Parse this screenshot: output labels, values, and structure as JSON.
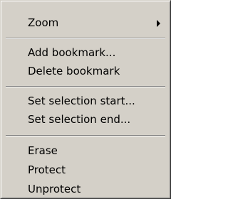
{
  "menu": {
    "groups": [
      {
        "items": [
          {
            "label": "Zoom",
            "has_submenu": true
          }
        ]
      },
      {
        "items": [
          {
            "label": "Add bookmark..."
          },
          {
            "label": "Delete bookmark"
          }
        ]
      },
      {
        "items": [
          {
            "label": "Set selection start..."
          },
          {
            "label": "Set selection end..."
          }
        ]
      },
      {
        "items": [
          {
            "label": "Erase"
          },
          {
            "label": "Protect"
          },
          {
            "label": "Unprotect"
          }
        ]
      }
    ],
    "submenu_arrow_icon": "submenu-arrow-icon"
  }
}
